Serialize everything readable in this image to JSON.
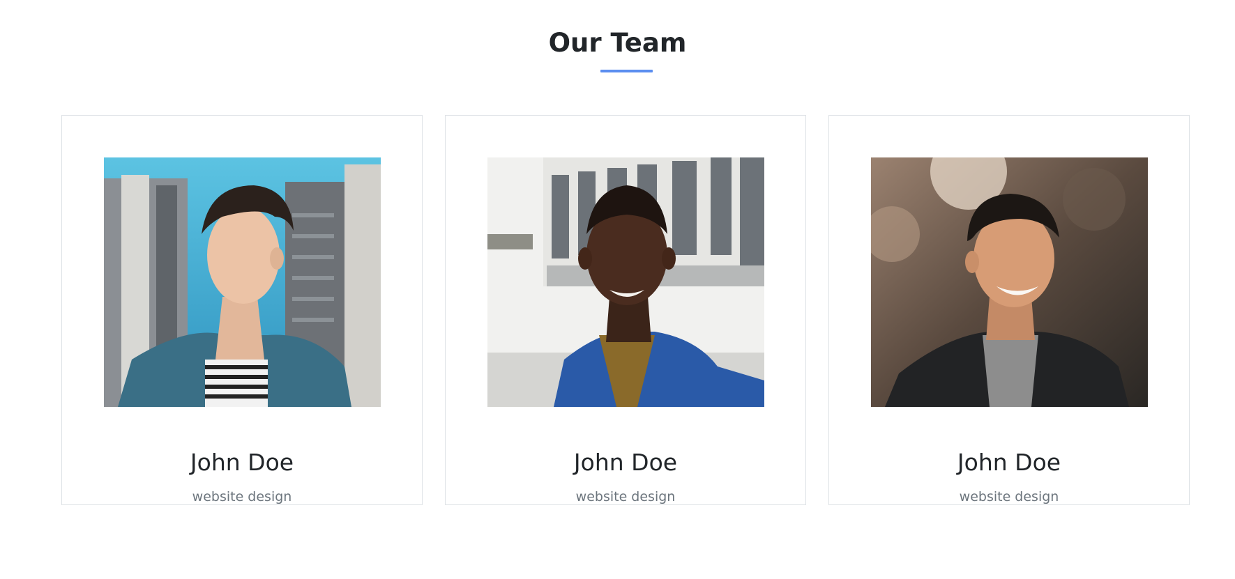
{
  "section": {
    "title": "Our Team",
    "accent_color": "#5b8ef0"
  },
  "members": [
    {
      "name": "John Doe",
      "role": "website design",
      "photo": "portrait-photo"
    },
    {
      "name": "John Doe",
      "role": "website design",
      "photo": "portrait-photo"
    },
    {
      "name": "John Doe",
      "role": "website design",
      "photo": "portrait-photo"
    }
  ]
}
